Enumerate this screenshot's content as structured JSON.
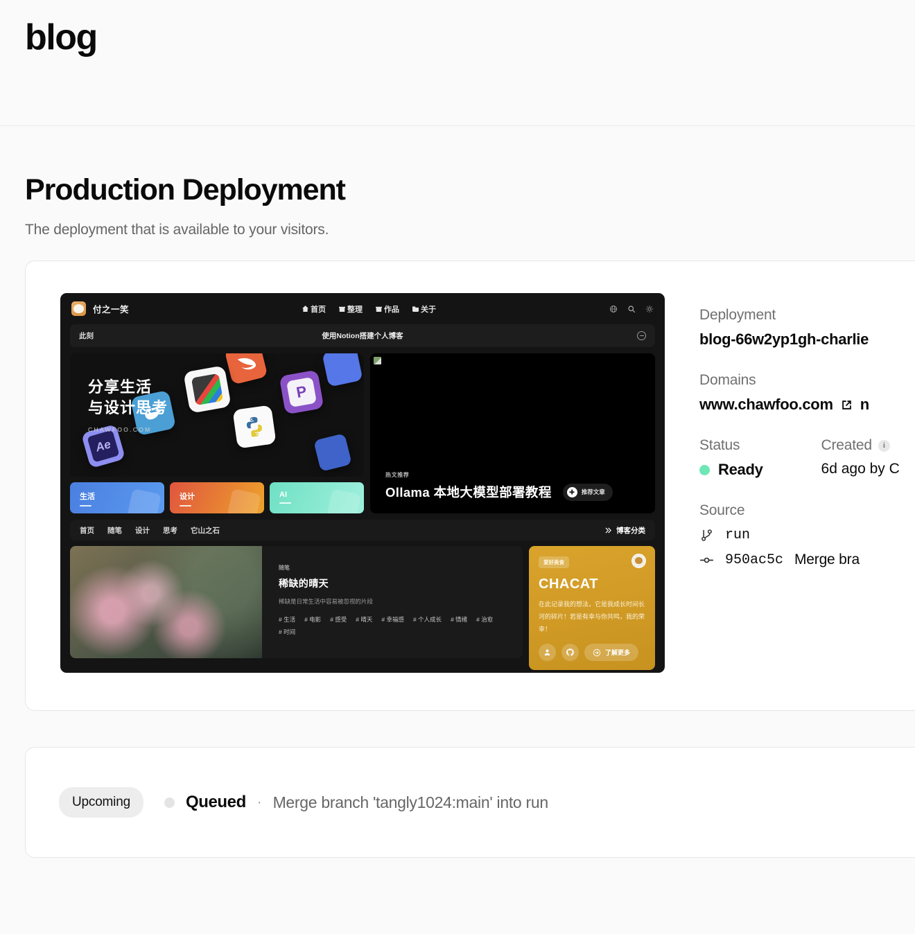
{
  "header": {
    "brand": "blog"
  },
  "page": {
    "title": "Production Deployment",
    "subtitle": "The deployment that is available to your visitors."
  },
  "meta": {
    "deployment_label": "Deployment",
    "deployment_value": "blog-66w2yp1gh-charlie",
    "domains_label": "Domains",
    "domain_primary": "www.chawfoo.com",
    "domain_secondary": "n",
    "status_label": "Status",
    "status_value": "Ready",
    "status_color": "#6ee7b7",
    "created_label": "Created",
    "created_info": "i",
    "created_value": "6d ago by C",
    "source_label": "Source",
    "source_branch": "run",
    "source_commit": "950ac5c",
    "source_message": "Merge bra"
  },
  "upcoming": {
    "badge": "Upcoming",
    "state": "Queued",
    "separator": "·",
    "message": "Merge branch 'tangly1024:main' into run"
  },
  "preview": {
    "logo_text": "付之一笑",
    "nav": [
      {
        "label": "首页",
        "icon": "home"
      },
      {
        "label": "整理",
        "icon": "box"
      },
      {
        "label": "作品",
        "icon": "box"
      },
      {
        "label": "关于",
        "icon": "folder"
      }
    ],
    "tools": [
      "globe-icon",
      "search-icon",
      "sun-icon"
    ],
    "banner_left": "此刻",
    "banner_center": "使用Notion搭建个人博客",
    "hero": {
      "line1": "分享生活",
      "line2": "与设计思考",
      "url": "CHAWFOO.COM"
    },
    "categories": [
      {
        "label": "生活",
        "color_from": "#4a7fe0",
        "color_to": "#5b9bf0"
      },
      {
        "label": "设计",
        "color_from": "#e0553f",
        "color_to": "#eda32a"
      },
      {
        "label": "AI",
        "color_from": "#6fe0c4",
        "color_to": "#9ff0dc"
      }
    ],
    "video": {
      "kicker": "热文推荐",
      "title": "Ollama 本地大模型部署教程",
      "pill": "推荐文章"
    },
    "tabs": [
      "首页",
      "随笔",
      "设计",
      "思考",
      "它山之石"
    ],
    "tabs_right": "博客分类",
    "article": {
      "kicker": "随笔",
      "title": "稀缺的晴天",
      "desc": "稀缺是日常生活中容易被忽视的片段",
      "tags": [
        "# 生活",
        "# 电影",
        "# 感受",
        "# 晴天",
        "# 幸福感",
        "# 个人成长",
        "# 情绪",
        "# 治愈",
        "# 时间"
      ]
    },
    "promo": {
      "badge": "爱好美食",
      "title": "CHACAT",
      "desc": "在此记录我的想法，它是我成长时间长河的碎片！若是有幸与你共鸣，我的荣幸！",
      "more": "了解更多"
    }
  }
}
